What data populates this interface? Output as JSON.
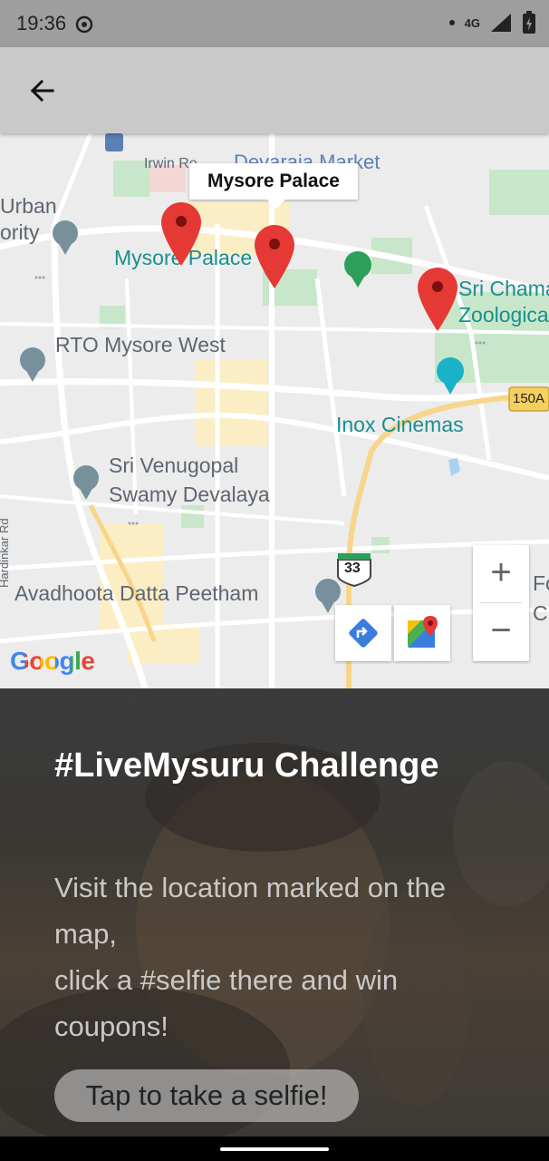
{
  "status_bar": {
    "time": "19:36",
    "network": "4G",
    "icons": [
      "data-saver-icon",
      "dot-icon",
      "signal-icon",
      "battery-icon"
    ]
  },
  "app_bar": {
    "back_icon": "arrow-back-icon"
  },
  "map": {
    "callout_title": "Mysore Palace",
    "labels": {
      "irwin_rd": "Irwin Ro",
      "market": "Devaraja Market",
      "urban": "Urban",
      "authority": "ority",
      "mysore_palace": "Mysore Palace",
      "zoo_1": "Sri Chama",
      "zoo_2": "Zoologica",
      "rto": "RTO Mysore West",
      "highway_150a": "150A",
      "inox": "Inox Cinemas",
      "venugopal_1": "Sri Venugopal",
      "venugopal_2": "Swamy Devalaya",
      "road_side": "Hardinkar Rd",
      "highway_33": "33",
      "avadhoota": "Avadhoota Datta Peetham",
      "edge_fo": "Fo",
      "edge_c": "C"
    },
    "zoom_in": "+",
    "zoom_out": "−",
    "google_logo": "Google",
    "colors": {
      "pin": "#e53935",
      "teal_label": "#1a8f8f",
      "road": "#ffffff",
      "park": "#c8e6c9"
    }
  },
  "panel": {
    "title": "#LiveMysuru Challenge",
    "description": "Visit the location marked on the map,\nclick a #selfie there and win coupons!",
    "button_label": "Tap to take a selfie!"
  }
}
